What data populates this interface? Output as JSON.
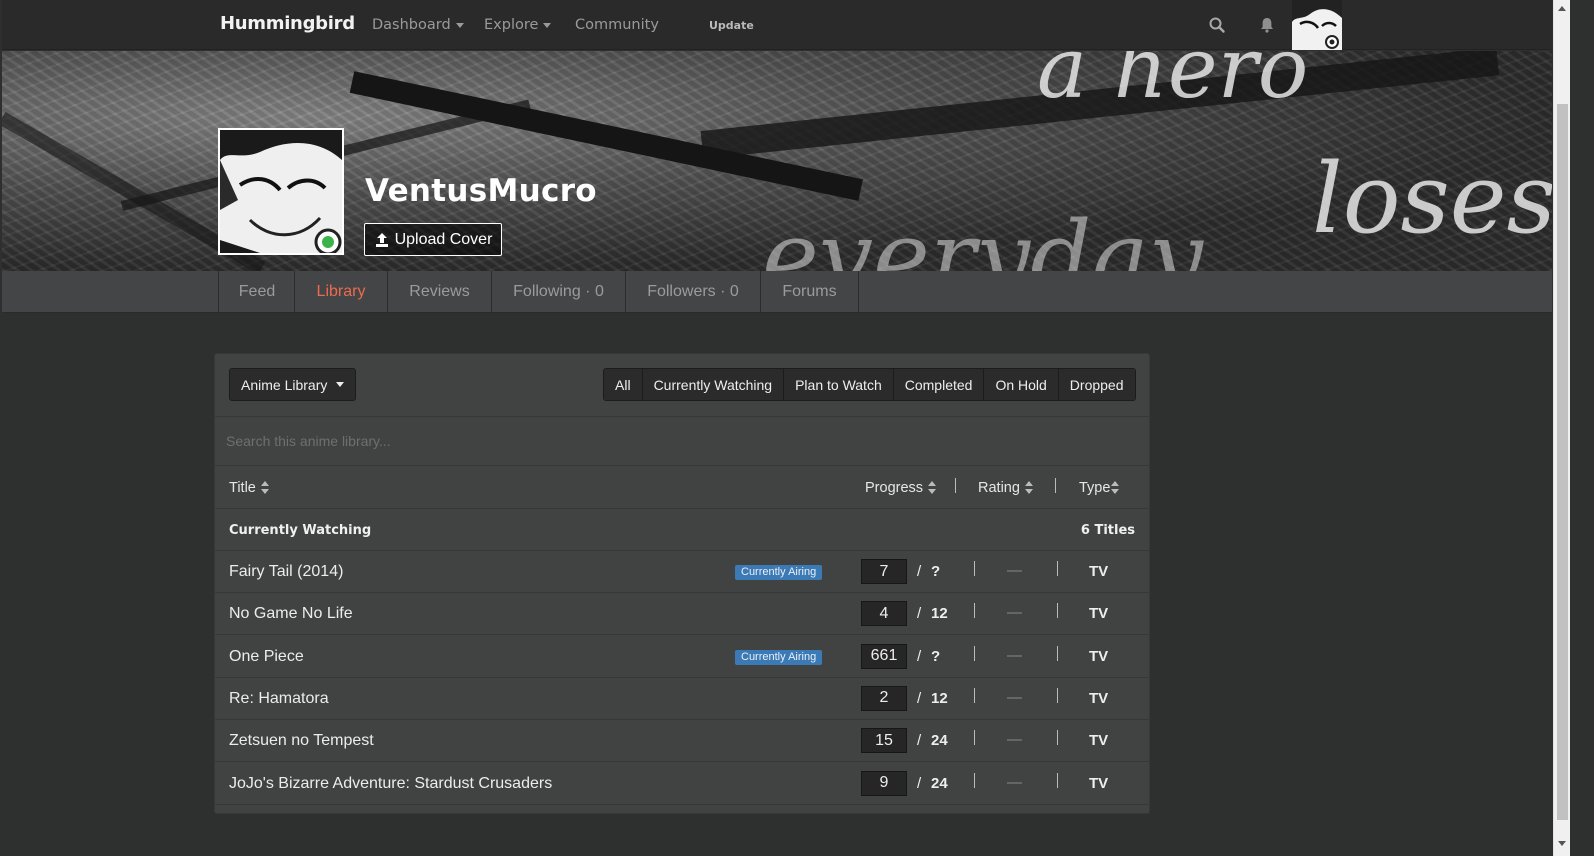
{
  "navbar": {
    "brand": "Hummingbird",
    "dashboard": "Dashboard",
    "explore": "Explore",
    "community": "Community",
    "update": "Update",
    "search_icon": "search-icon",
    "notification_icon": "bell-icon"
  },
  "profile": {
    "username": "VentusMucro",
    "upload_cover": "Upload Cover",
    "cover_text": [
      "a hero",
      "loses",
      "everyday"
    ]
  },
  "tabs": [
    {
      "label": "Feed"
    },
    {
      "label": "Library"
    },
    {
      "label": "Reviews"
    },
    {
      "label": "Following · 0"
    },
    {
      "label": "Followers · 0"
    },
    {
      "label": "Forums"
    }
  ],
  "library": {
    "dropdown_label": "Anime Library",
    "filters": [
      "All",
      "Currently Watching",
      "Plan to Watch",
      "Completed",
      "On Hold",
      "Dropped"
    ],
    "search_placeholder": "Search this anime library...",
    "columns": {
      "title": "Title",
      "progress": "Progress",
      "rating": "Rating",
      "type": "Type"
    },
    "group": {
      "name": "Currently Watching",
      "count": "6 Titles"
    },
    "airing_badge": "Currently Airing",
    "rows": [
      {
        "title": "Fairy Tail (2014)",
        "airing": true,
        "progress": "7",
        "total": "?",
        "rating": "—",
        "type": "TV"
      },
      {
        "title": "No Game No Life",
        "airing": false,
        "progress": "4",
        "total": "12",
        "rating": "—",
        "type": "TV"
      },
      {
        "title": "One Piece",
        "airing": true,
        "progress": "661",
        "total": "?",
        "rating": "—",
        "type": "TV"
      },
      {
        "title": "Re: Hamatora",
        "airing": false,
        "progress": "2",
        "total": "12",
        "rating": "—",
        "type": "TV"
      },
      {
        "title": "Zetsuen no Tempest",
        "airing": false,
        "progress": "15",
        "total": "24",
        "rating": "—",
        "type": "TV"
      },
      {
        "title": "JoJo's Bizarre Adventure: Stardust Crusaders",
        "airing": false,
        "progress": "9",
        "total": "24",
        "rating": "—",
        "type": "TV"
      }
    ]
  },
  "colors": {
    "accent_active_tab": "#ec6b4f",
    "airing_badge": "#3c7ab6",
    "background": "#2e2f2f",
    "panel": "#414242"
  }
}
